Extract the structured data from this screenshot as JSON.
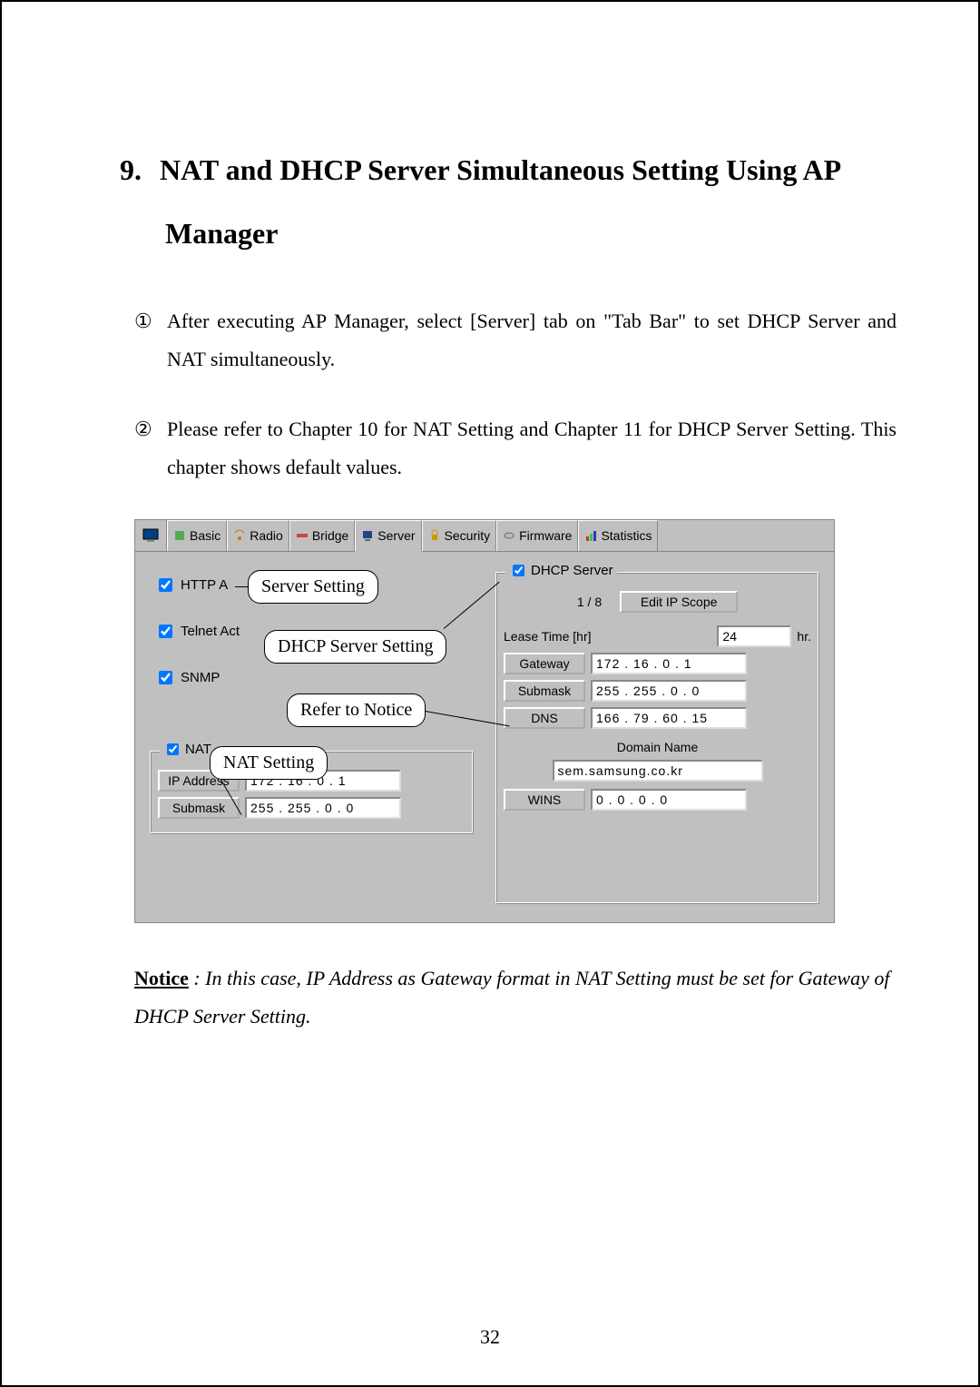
{
  "heading_number": "9.",
  "heading_text": "NAT and DHCP Server Simultaneous Setting Using AP Manager",
  "steps": [
    {
      "marker": "①",
      "text": "After executing AP Manager, select [Server] tab on \"Tab Bar\" to set DHCP Server and NAT simultaneously."
    },
    {
      "marker": "②",
      "text": "Please refer to Chapter 10 for NAT Setting and Chapter 11 for DHCP Server Setting. This chapter shows default values."
    }
  ],
  "tabs": [
    "Basic",
    "Radio",
    "Bridge",
    "Server",
    "Security",
    "Firmware",
    "Statistics"
  ],
  "active_tab_index": 3,
  "left": {
    "http_label": "HTTP A",
    "telnet_label": "Telnet Act",
    "snmp_label": "SNMP",
    "nat_legend": "NAT",
    "ip_label": "IP Address",
    "ip_value": "172 . 16  .  0   .  1",
    "submask_label": "Submask",
    "submask_value": "255 . 255 .  0   .  0"
  },
  "right": {
    "dhcp_legend": "DHCP Server",
    "scope_counter": "1 / 8",
    "edit_scope_btn": "Edit IP Scope",
    "lease_label": "Lease Time [hr]",
    "lease_value": "24",
    "lease_unit": "hr.",
    "gateway_label": "Gateway",
    "gateway_value": "172 . 16  .  0   .  1",
    "submask_label": "Submask",
    "submask_value": "255 . 255 .  0   .  0",
    "dns_label": "DNS",
    "dns_value": "166 . 79  . 60  . 15",
    "domain_label": "Domain Name",
    "domain_value": "sem.samsung.co.kr",
    "wins_label": "WINS",
    "wins_value": "0   .  0   .  0   .  0"
  },
  "callouts": {
    "server_setting": "Server Setting",
    "dhcp_server_setting": "DHCP Server Setting",
    "refer_notice": "Refer to Notice",
    "nat_setting": "NAT Setting"
  },
  "notice_label": "Notice",
  "notice_text": " : In this case, IP Address as Gateway format in NAT Setting must be set for Gateway of DHCP Server Setting.",
  "page_number": "32"
}
